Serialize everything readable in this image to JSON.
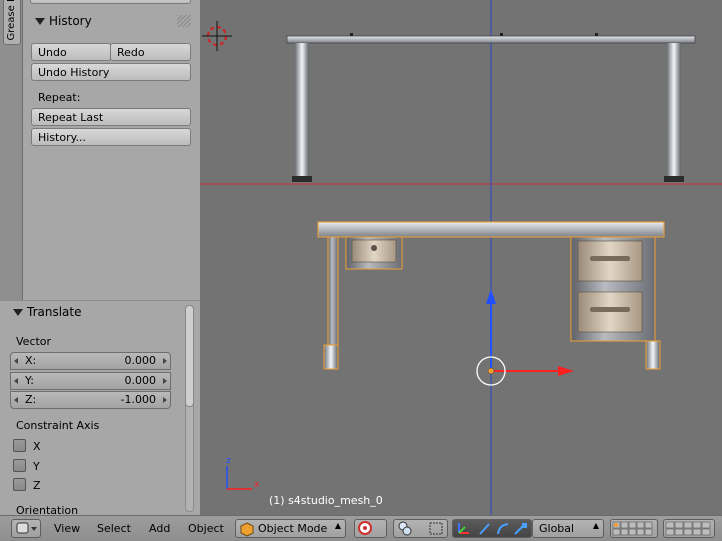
{
  "tool_shelf": {
    "tab_label": "Grease P",
    "history_panel": {
      "title": "History",
      "undo_label": "Undo",
      "redo_label": "Redo",
      "undo_history_label": "Undo History",
      "repeat_heading": "Repeat:",
      "repeat_last_label": "Repeat Last",
      "history_label": "History..."
    }
  },
  "operator_panel": {
    "title": "Translate",
    "vector_label": "Vector",
    "vector": [
      {
        "axis": "X:",
        "value": "0.000"
      },
      {
        "axis": "Y:",
        "value": "0.000"
      },
      {
        "axis": "Z:",
        "value": "-1.000"
      }
    ],
    "constraint_label": "Constraint Axis",
    "constraints": [
      {
        "label": "X",
        "checked": false
      },
      {
        "label": "Y",
        "checked": false
      },
      {
        "label": "Z",
        "checked": false
      }
    ],
    "orientation_label": "Orientation"
  },
  "viewport": {
    "object_label": "(1) s4studio_mesh_0",
    "axis_gizmo": {
      "z": "z",
      "x": "x"
    },
    "colors": {
      "selection": "#f0a030",
      "x_axis": "#ff2020",
      "z_axis": "#2050ff",
      "background": "#737373"
    }
  },
  "header": {
    "menus": [
      "View",
      "Select",
      "Add",
      "Object"
    ],
    "mode": "Object Mode",
    "orientation": "Global"
  }
}
